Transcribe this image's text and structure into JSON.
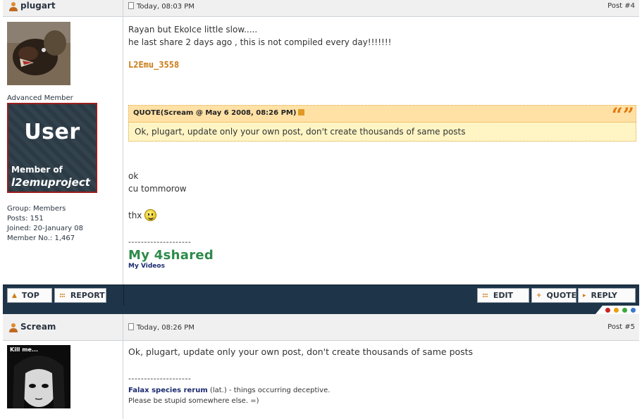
{
  "post1": {
    "author": "plugart",
    "timestamp": "Today, 08:03 PM",
    "post_number": "Post #4",
    "rank": "Advanced Member",
    "badge": {
      "line1": "User",
      "line2": "Member of",
      "line3": "l2emuproject"
    },
    "stats": {
      "group": "Group: Members",
      "posts": "Posts: 151",
      "joined": "Joined: 20-January 08",
      "member_no": "Member No.: 1,467"
    },
    "text_line1": "Rayan but EkoIce little slow.....",
    "text_line2": "he last share 2 days ago , this is not compiled every day!!!!!!!",
    "l2emu_link": "L2Emu_3558",
    "quote": {
      "header": "QUOTE(Scream @ May 6 2008, 08:26 PM)",
      "body": "Ok, plugart, update only your own post, don't create thousands of same posts"
    },
    "reply_line1": "ok",
    "reply_line2": "cu tommorow",
    "thx": "thx",
    "signature_divider": "--------------------",
    "signature_title": "My 4shared",
    "signature_sub": "My Videos"
  },
  "actions": {
    "top": "TOP",
    "report": "REPORT",
    "edit": "EDIT",
    "quote": "QUOTE",
    "reply": "REPLY"
  },
  "separator_dot_colors": [
    "#cc2222",
    "#e8a010",
    "#3aaa3a",
    "#3a7ac8"
  ],
  "post2": {
    "author": "Scream",
    "timestamp": "Today, 08:26 PM",
    "post_number": "Post #5",
    "avatar_caption": "Kill me...",
    "text": "Ok, plugart, update only your own post, don't create thousands of same posts",
    "signature_divider": "--------------------",
    "sig_bold": "Falax species rerum",
    "sig_rest": " (lat.) - things occurring deceptive.",
    "sig_line2": "Please be stupid somewhere else. =)"
  }
}
